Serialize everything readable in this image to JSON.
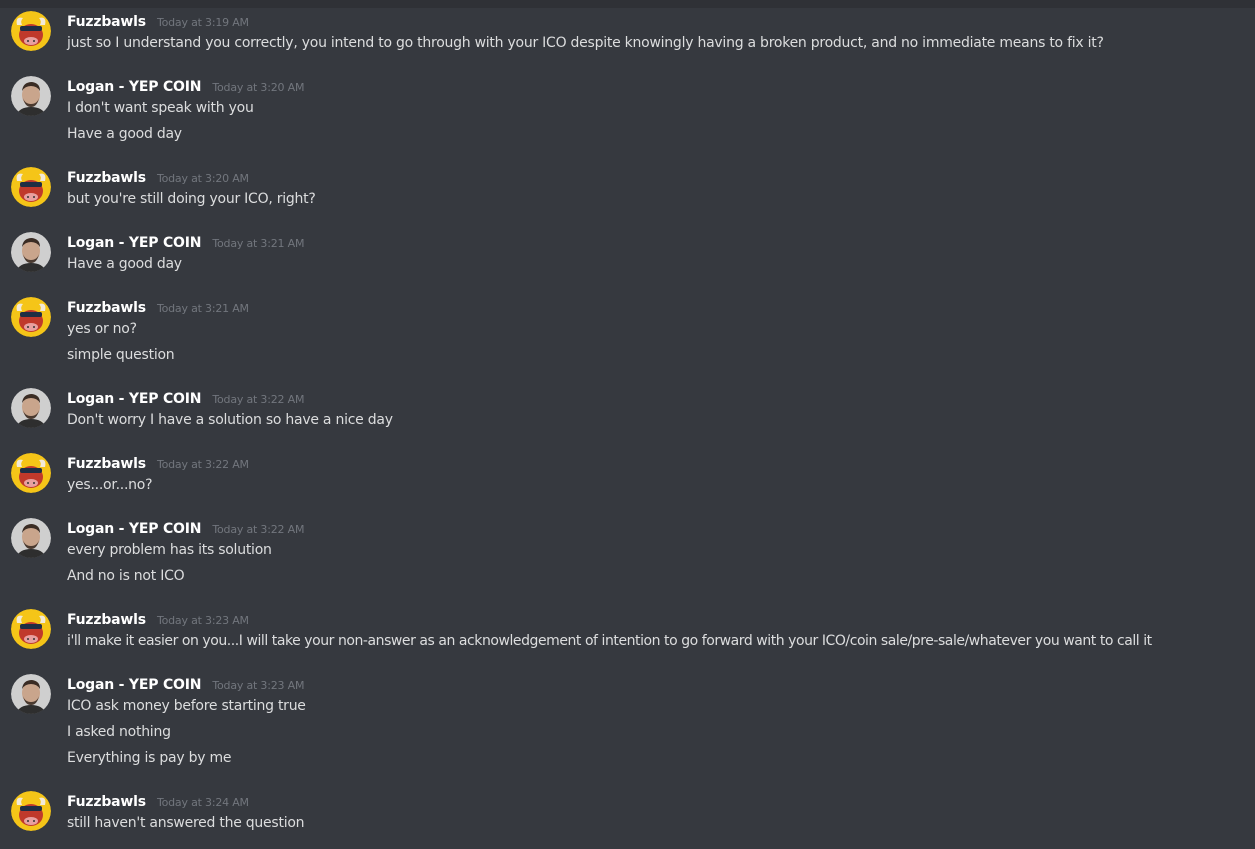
{
  "messages": [
    {
      "author": "Fuzzbawls",
      "time": "Today at 3:19 AM",
      "avatar": "bull-avatar",
      "lines": [
        "just so I understand you correctly, you intend to go through with your ICO despite knowingly having a broken product, and no immediate means to fix it?"
      ]
    },
    {
      "author": "Logan - YEP COIN",
      "time": "Today at 3:20 AM",
      "avatar": "person-avatar",
      "lines": [
        "I don't want speak with you",
        "Have a good day"
      ]
    },
    {
      "author": "Fuzzbawls",
      "time": "Today at 3:20 AM",
      "avatar": "bull-avatar",
      "lines": [
        "but you're still doing your ICO, right?"
      ]
    },
    {
      "author": "Logan - YEP COIN",
      "time": "Today at 3:21 AM",
      "avatar": "person-avatar",
      "lines": [
        "Have a good day"
      ]
    },
    {
      "author": "Fuzzbawls",
      "time": "Today at 3:21 AM",
      "avatar": "bull-avatar",
      "lines": [
        "yes or no?",
        "simple question"
      ]
    },
    {
      "author": "Logan - YEP COIN",
      "time": "Today at 3:22 AM",
      "avatar": "person-avatar",
      "lines": [
        "Don't worry I have a solution so have a nice day"
      ]
    },
    {
      "author": "Fuzzbawls",
      "time": "Today at 3:22 AM",
      "avatar": "bull-avatar",
      "lines": [
        "yes...or...no?"
      ]
    },
    {
      "author": "Logan - YEP COIN",
      "time": "Today at 3:22 AM",
      "avatar": "person-avatar",
      "lines": [
        "every problem has its solution",
        "And no is not ICO"
      ]
    },
    {
      "author": "Fuzzbawls",
      "time": "Today at 3:23 AM",
      "avatar": "bull-avatar",
      "lines": [
        "i'll make it easier on you...I will take your non-answer as an acknowledgement of intention to go forward with your ICO/coin sale/pre-sale/whatever you want to call it"
      ]
    },
    {
      "author": "Logan - YEP COIN",
      "time": "Today at 3:23 AM",
      "avatar": "person-avatar",
      "lines": [
        "ICO ask money before starting true",
        "I asked nothing",
        "Everything is pay by me"
      ]
    },
    {
      "author": "Fuzzbawls",
      "time": "Today at 3:24 AM",
      "avatar": "bull-avatar",
      "lines": [
        "still haven't answered the question"
      ]
    }
  ]
}
